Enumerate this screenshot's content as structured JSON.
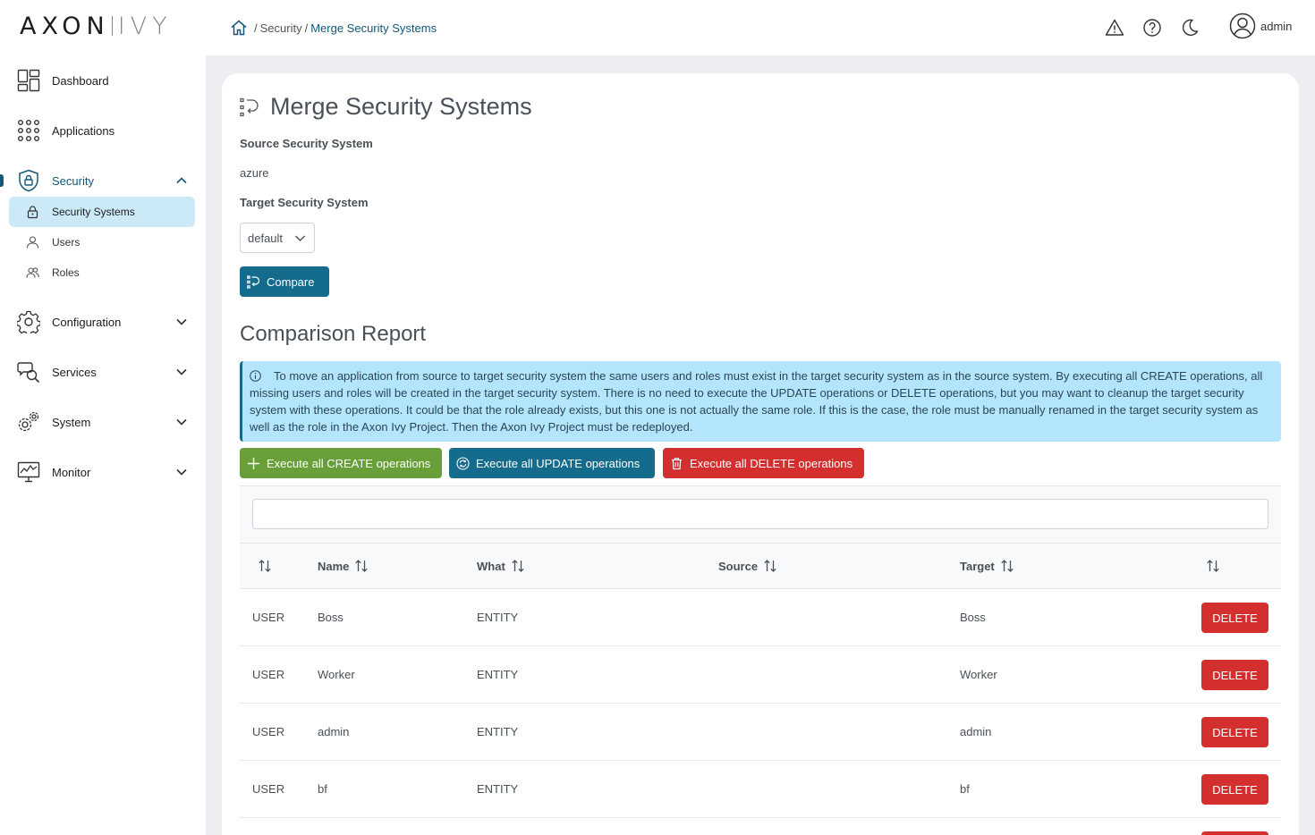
{
  "logo": {
    "part1": "AXON",
    "part2": "IVY"
  },
  "sidebar": {
    "items": [
      {
        "label": "Dashboard",
        "icon": "dashboard-icon"
      },
      {
        "label": "Applications",
        "icon": "apps-grid-icon"
      },
      {
        "label": "Security",
        "icon": "shield-lock-icon",
        "expanded": true
      },
      {
        "label": "Configuration",
        "icon": "gear-icon"
      },
      {
        "label": "Services",
        "icon": "services-icon"
      },
      {
        "label": "System",
        "icon": "gears-icon"
      },
      {
        "label": "Monitor",
        "icon": "monitor-icon"
      }
    ],
    "security_sub": [
      {
        "label": "Security Systems",
        "icon": "lock-icon",
        "selected": true
      },
      {
        "label": "Users",
        "icon": "user-icon"
      },
      {
        "label": "Roles",
        "icon": "users-icon"
      }
    ]
  },
  "breadcrumb": {
    "security": "Security",
    "current": "Merge Security Systems"
  },
  "topbar": {
    "username": "admin"
  },
  "page": {
    "title": "Merge Security Systems",
    "source_label": "Source Security System",
    "source_value": "azure",
    "target_label": "Target Security System",
    "target_value": "default",
    "compare_button": "Compare",
    "report_title": "Comparison Report",
    "info_text": "To move an application from source to target security system the same users and roles must exist in the target security system as in the source system. By executing all CREATE operations, all missing users and roles will be created in the target security system. There is no need to execute the UPDATE operations or DELETE operations, but you may want to cleanup the target security system with these operations. It could be that the role already exists, but this one is not actually the same role. If this is the case, the role must be manually renamed in the target security system as well as the role in the Axon Ivy Project. Then the Axon Ivy Project must be redeployed.",
    "create_all": "Execute all CREATE operations",
    "update_all": "Execute all UPDATE operations",
    "delete_all": "Execute all DELETE operations"
  },
  "table": {
    "filter_value": "",
    "columns": [
      "",
      "Name",
      "What",
      "Source",
      "Target",
      ""
    ],
    "rows": [
      {
        "type": "USER",
        "name": "Boss",
        "what": "ENTITY",
        "source": "",
        "target": "Boss",
        "action": "DELETE"
      },
      {
        "type": "USER",
        "name": "Worker",
        "what": "ENTITY",
        "source": "",
        "target": "Worker",
        "action": "DELETE"
      },
      {
        "type": "USER",
        "name": "admin",
        "what": "ENTITY",
        "source": "",
        "target": "admin",
        "action": "DELETE"
      },
      {
        "type": "USER",
        "name": "bf",
        "what": "ENTITY",
        "source": "",
        "target": "bf",
        "action": "DELETE"
      }
    ]
  },
  "colors": {
    "primary": "#146b8c",
    "create": "#689f38",
    "delete": "#d32f2f",
    "info_bg": "#b3e5fc",
    "nav_selected_bg": "#cce9f8"
  }
}
